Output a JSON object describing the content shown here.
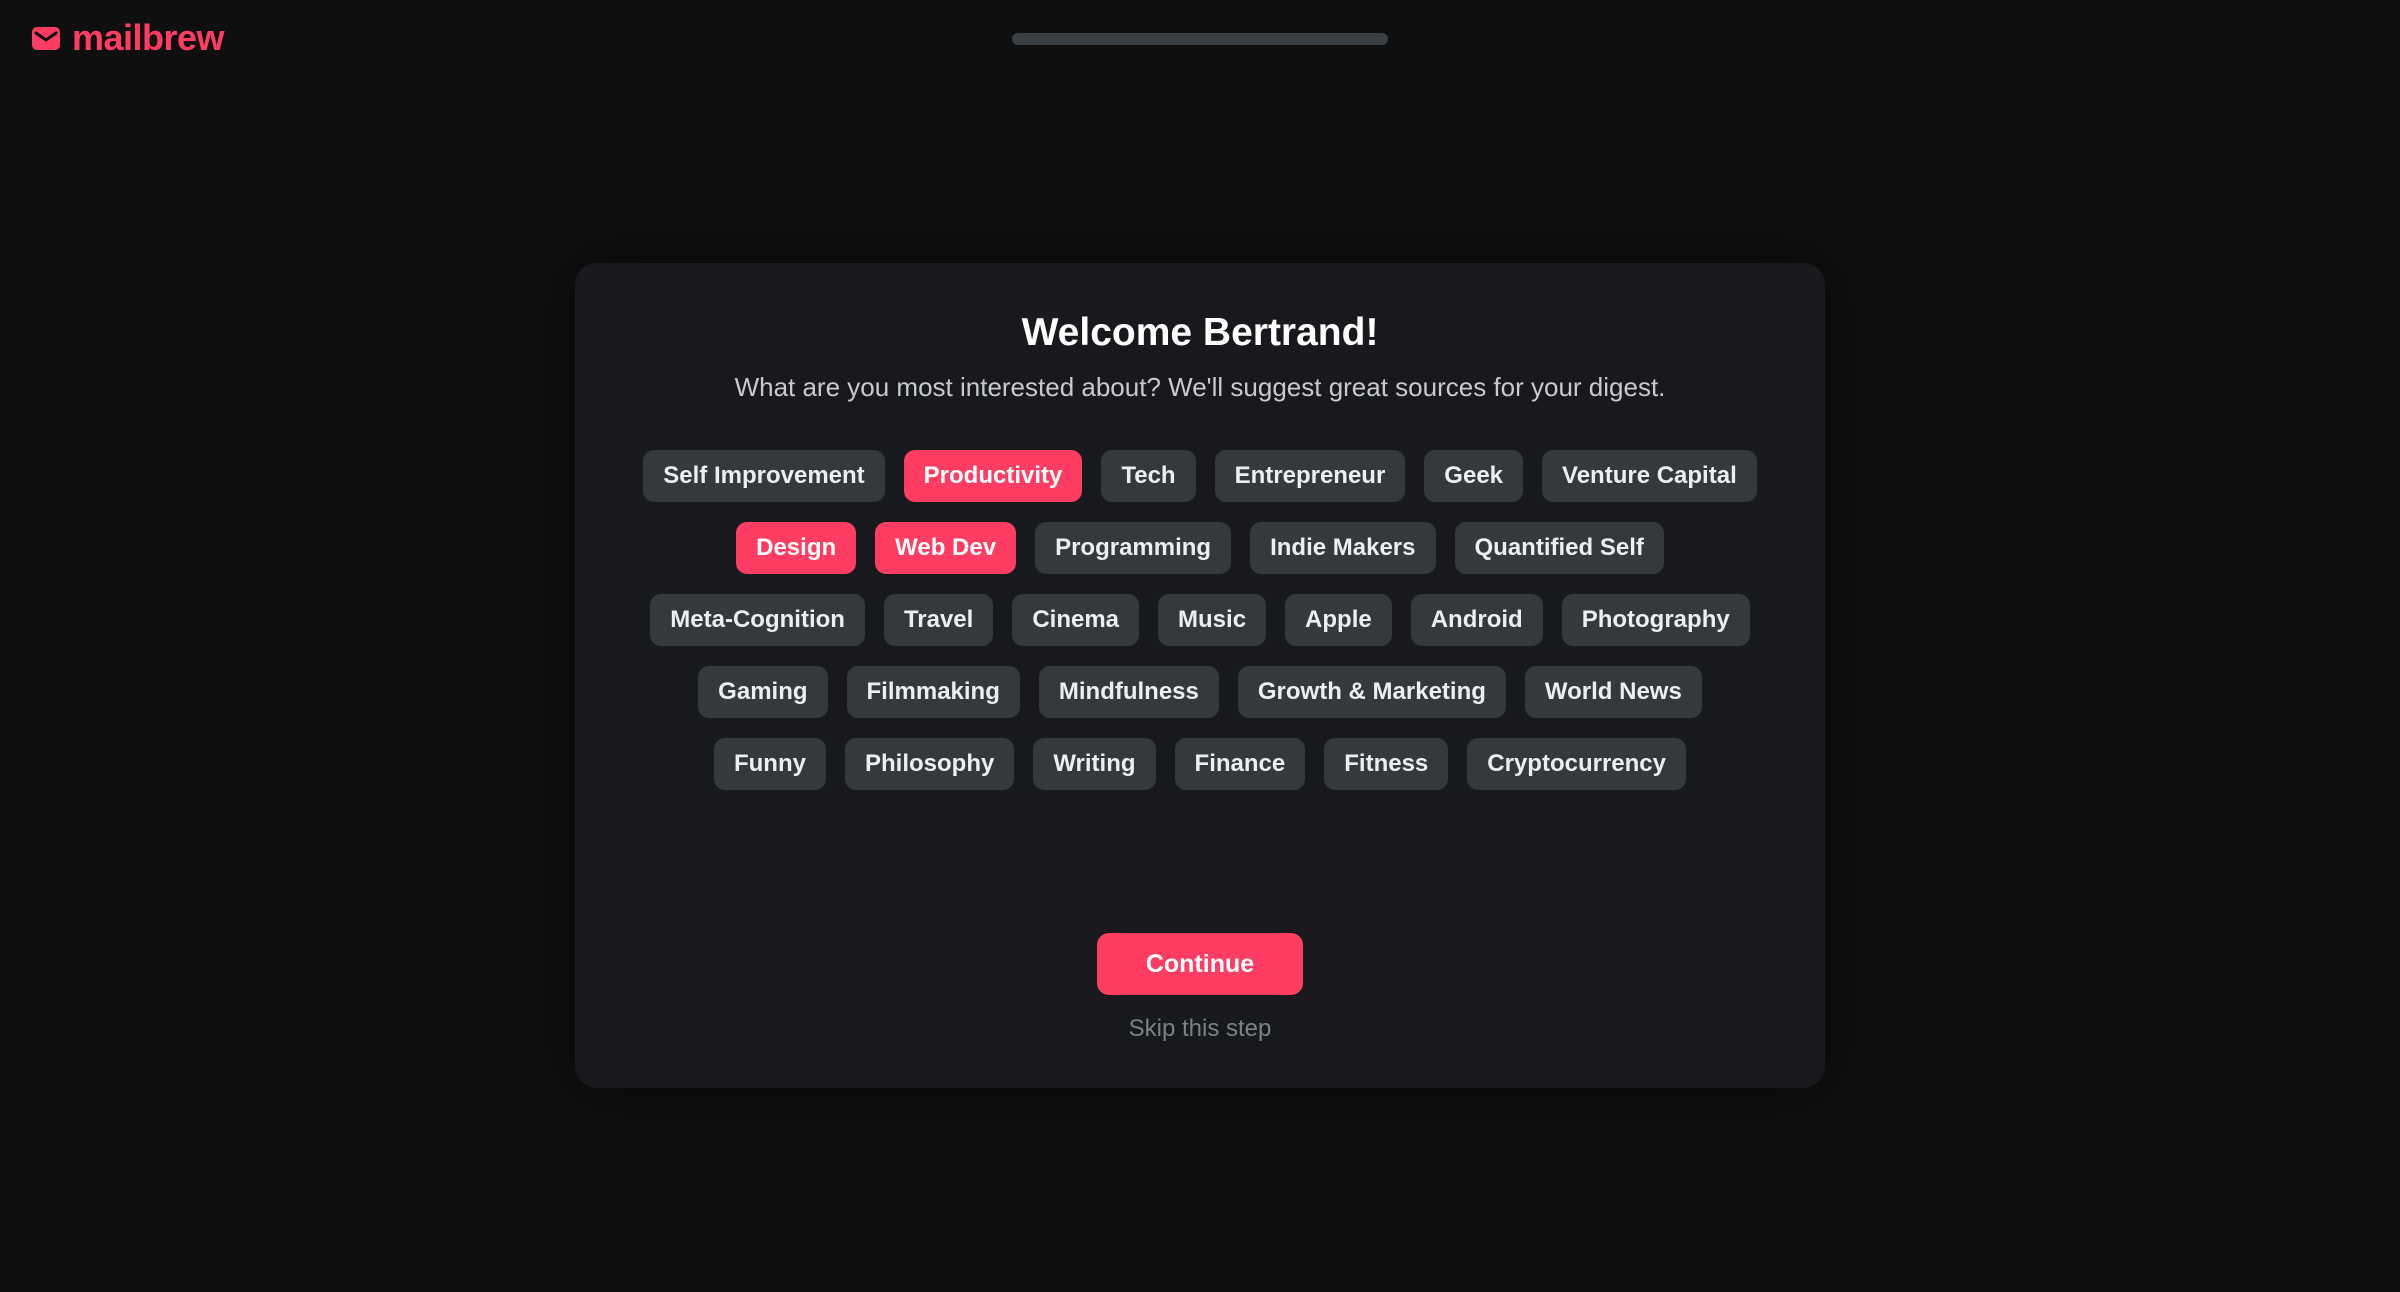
{
  "brand": {
    "name": "mailbrew",
    "icon": "envelope-icon",
    "color": "#ff3d63"
  },
  "onboarding_progress": {
    "value_percent": 0
  },
  "card": {
    "title": "Welcome Bertrand!",
    "subtitle": "What are you most interested about? We'll suggest great sources for your digest.",
    "tag_rows": [
      [
        {
          "label": "Self Improvement",
          "selected": false
        },
        {
          "label": "Productivity",
          "selected": true
        },
        {
          "label": "Tech",
          "selected": false
        },
        {
          "label": "Entrepreneur",
          "selected": false
        },
        {
          "label": "Geek",
          "selected": false
        },
        {
          "label": "Venture Capital",
          "selected": false
        }
      ],
      [
        {
          "label": "Design",
          "selected": true
        },
        {
          "label": "Web Dev",
          "selected": true
        },
        {
          "label": "Programming",
          "selected": false
        },
        {
          "label": "Indie Makers",
          "selected": false
        },
        {
          "label": "Quantified Self",
          "selected": false
        }
      ],
      [
        {
          "label": "Meta-Cognition",
          "selected": false
        },
        {
          "label": "Travel",
          "selected": false
        },
        {
          "label": "Cinema",
          "selected": false
        },
        {
          "label": "Music",
          "selected": false
        },
        {
          "label": "Apple",
          "selected": false
        },
        {
          "label": "Android",
          "selected": false
        },
        {
          "label": "Photography",
          "selected": false
        }
      ],
      [
        {
          "label": "Gaming",
          "selected": false
        },
        {
          "label": "Filmmaking",
          "selected": false
        },
        {
          "label": "Mindfulness",
          "selected": false
        },
        {
          "label": "Growth & Marketing",
          "selected": false
        },
        {
          "label": "World News",
          "selected": false
        }
      ],
      [
        {
          "label": "Funny",
          "selected": false
        },
        {
          "label": "Philosophy",
          "selected": false
        },
        {
          "label": "Writing",
          "selected": false
        },
        {
          "label": "Finance",
          "selected": false
        },
        {
          "label": "Fitness",
          "selected": false
        },
        {
          "label": "Cryptocurrency",
          "selected": false
        }
      ]
    ],
    "continue_label": "Continue",
    "skip_label": "Skip this step"
  },
  "colors": {
    "accent": "#ff3d63",
    "background": "#0f0f10",
    "card": "#17191c",
    "tag": "#35383c"
  }
}
